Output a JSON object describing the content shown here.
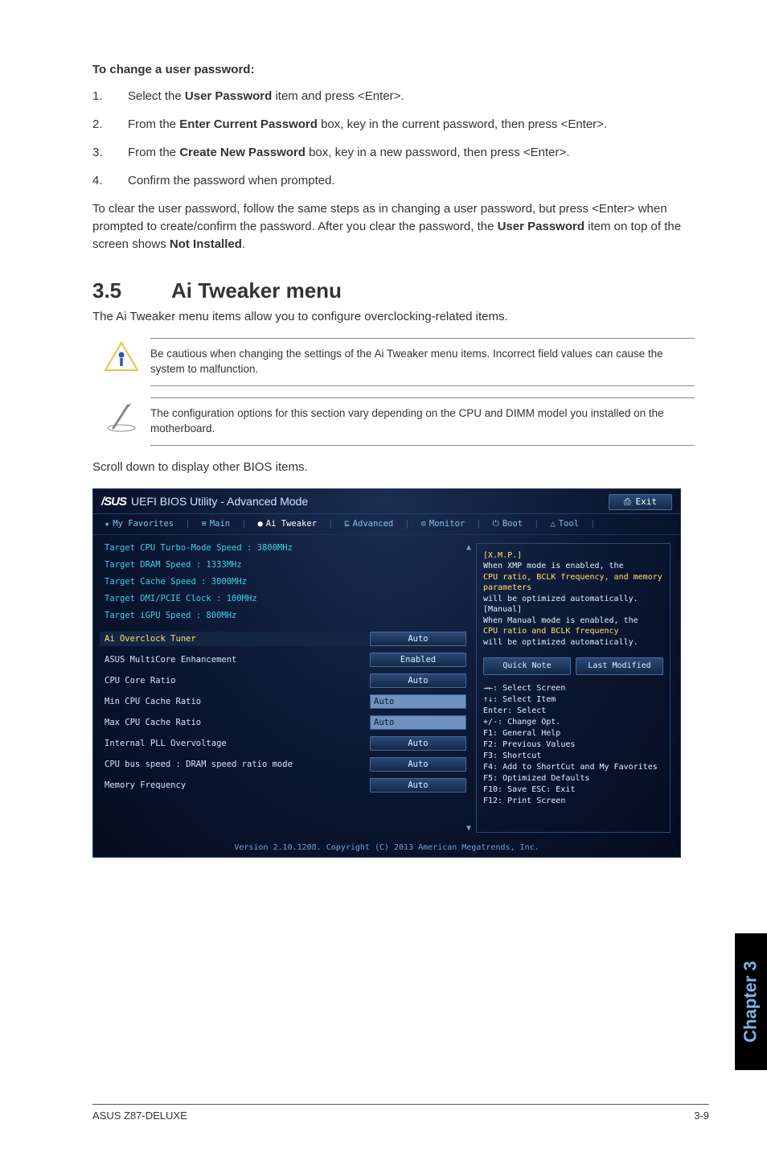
{
  "doc": {
    "change_pw_heading": "To change a user password:",
    "steps": [
      {
        "num": "1.",
        "pre": "Select the ",
        "b": "User Password",
        "post": " item and press <Enter>."
      },
      {
        "num": "2.",
        "pre": "From the ",
        "b": "Enter Current Password",
        "post": " box, key in the current password, then press <Enter>."
      },
      {
        "num": "3.",
        "pre": "From the ",
        "b": "Create New Password",
        "post": " box, key in a new password, then press <Enter>."
      },
      {
        "num": "4.",
        "pre": "Confirm the password when prompted.",
        "b": "",
        "post": ""
      }
    ],
    "clear_pw_para_pre": "To clear the user password, follow the same steps as in changing a user password, but press <Enter> when prompted to create/confirm the password. After you clear the password, the ",
    "clear_pw_b1": "User Password",
    "clear_pw_mid": " item on top of the screen shows ",
    "clear_pw_b2": "Not Installed",
    "clear_pw_post": ".",
    "section_num": "3.5",
    "section_title": "Ai Tweaker menu",
    "section_sub": "The Ai Tweaker menu items allow you to configure overclocking-related items.",
    "callout_warn": "Be cautious when changing the settings of the Ai Tweaker menu items. Incorrect field values can cause the system to malfunction.",
    "callout_note": "The configuration options for this section vary depending on the CPU and DIMM model you installed on the motherboard.",
    "scroll_hint": "Scroll down to display other BIOS items."
  },
  "bios": {
    "logo": "/SUS",
    "title": "UEFI BIOS Utility - Advanced Mode",
    "exit_label": "Exit",
    "tabs": [
      "My Favorites",
      "Main",
      "Ai Tweaker",
      "Advanced",
      "Monitor",
      "Boot",
      "Tool"
    ],
    "tab_icons": [
      "★",
      "≡",
      "●",
      "⊑",
      "⊙",
      "⏻",
      "△"
    ],
    "targets": [
      "Target CPU Turbo-Mode Speed : 3800MHz",
      "Target DRAM Speed : 1333MHz",
      "Target Cache Speed : 3000MHz",
      "Target DMI/PCIE Clock : 100MHz",
      "Target iGPU Speed : 800MHz"
    ],
    "settings": [
      {
        "label": "Ai Overclock Tuner",
        "ctrl": "pill",
        "value": "Auto",
        "highlight": true
      },
      {
        "label": "ASUS MultiCore Enhancement",
        "ctrl": "pill",
        "value": "Enabled"
      },
      {
        "label": "CPU Core Ratio",
        "ctrl": "pill",
        "value": "Auto"
      },
      {
        "label": "Min CPU Cache Ratio",
        "ctrl": "input",
        "value": "Auto"
      },
      {
        "label": "Max CPU Cache Ratio",
        "ctrl": "input",
        "value": "Auto"
      },
      {
        "label": "Internal PLL Overvoltage",
        "ctrl": "pill",
        "value": "Auto"
      },
      {
        "label": "CPU bus speed : DRAM speed ratio mode",
        "ctrl": "pill",
        "value": "Auto"
      },
      {
        "label": "Memory Frequency",
        "ctrl": "pill",
        "value": "Auto"
      }
    ],
    "help": {
      "h1": "[X.M.P.]",
      "l1": "When XMP mode is enabled, the",
      "y1": "CPU ratio, BCLK frequency, and memory parameters",
      "l2": "will be optimized automatically.",
      "h2": "[Manual]",
      "l3": "When Manual mode is enabled, the",
      "y2": "CPU ratio and BCLK frequency",
      "l4": "will be optimized automatically."
    },
    "quick_note": "Quick Note",
    "last_modified": "Last Modified",
    "keys": [
      "→←: Select Screen",
      "↑↓: Select Item",
      "Enter: Select",
      "+/-: Change Opt.",
      "F1: General Help",
      "F2: Previous Values",
      "F3: Shortcut",
      "F4: Add to ShortCut and My Favorites",
      "F5: Optimized Defaults",
      "F10: Save  ESC: Exit",
      "F12: Print Screen"
    ],
    "version": "Version 2.10.1208. Copyright (C) 2013 American Megatrends, Inc."
  },
  "footer": {
    "left": "ASUS Z87-DELUXE",
    "right": "3-9"
  },
  "sidebar": {
    "chapter": "Chapter 3"
  }
}
